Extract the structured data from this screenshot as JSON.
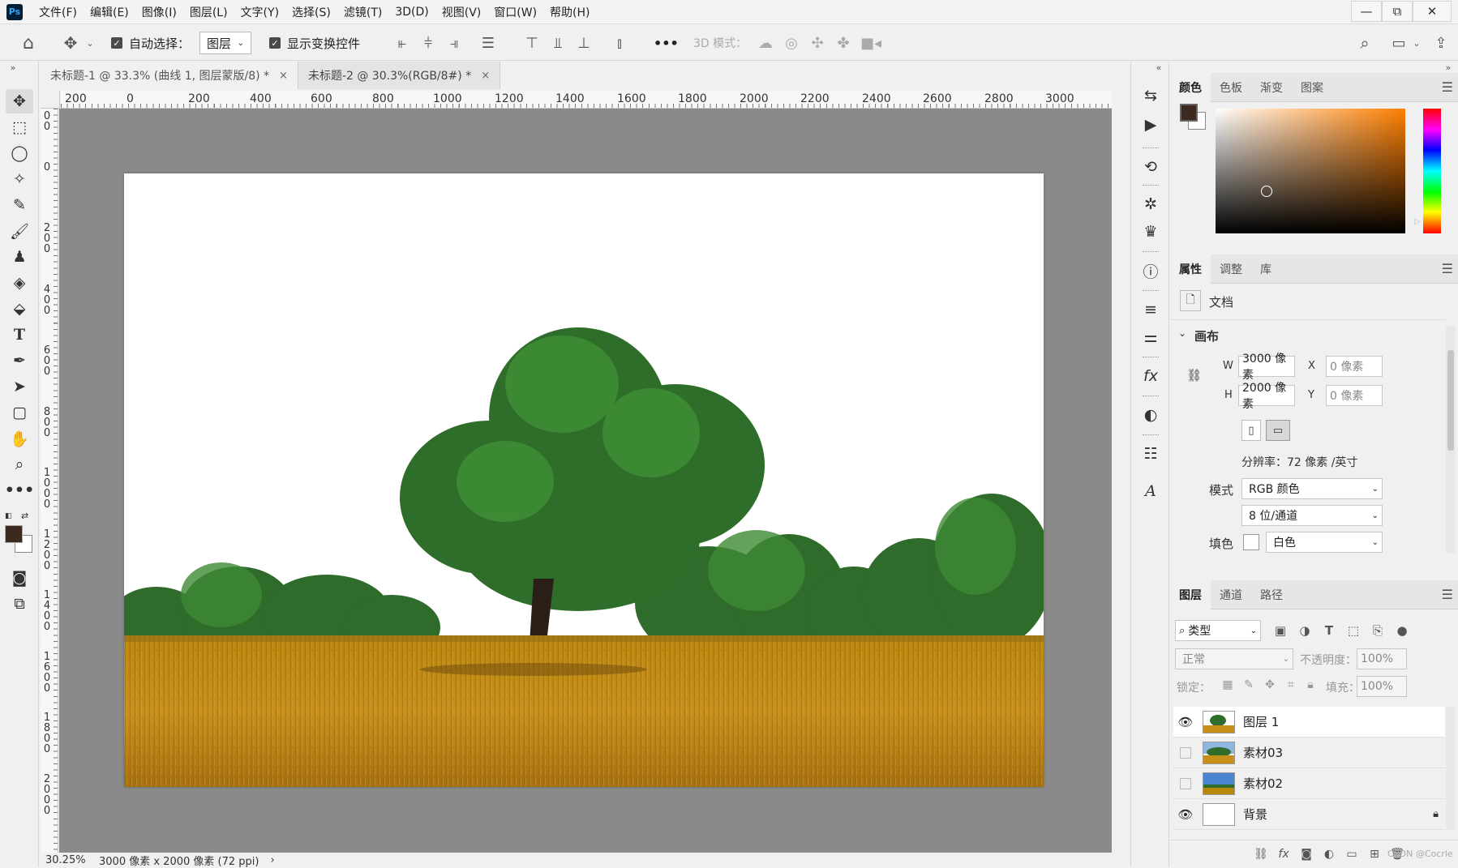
{
  "app": {
    "logo": "Ps"
  },
  "menu": [
    "文件(F)",
    "编辑(E)",
    "图像(I)",
    "图层(L)",
    "文字(Y)",
    "选择(S)",
    "滤镜(T)",
    "3D(D)",
    "视图(V)",
    "窗口(W)",
    "帮助(H)"
  ],
  "window_controls": {
    "minimize": "—",
    "restore": "⧉",
    "close": "✕"
  },
  "options": {
    "auto_select_label": "自动选择：",
    "auto_select_value": "图层",
    "show_transform_label": "显示变换控件",
    "more": "•••",
    "mode_3d_label": "3D 模式："
  },
  "tabs": [
    {
      "label": "未标题-1 @ 33.3% (曲线 1, 图层蒙版/8) *",
      "close": "×"
    },
    {
      "label": "未标题-2 @ 30.3%(RGB/8#) *",
      "close": "×"
    }
  ],
  "ruler_top": [
    "200",
    "0",
    "200",
    "400",
    "600",
    "800",
    "1000",
    "1200",
    "1400",
    "1600",
    "1800",
    "2000",
    "2200",
    "2400",
    "2600",
    "2800",
    "3000"
  ],
  "ruler_left": [
    "200",
    "0",
    "200",
    "400",
    "600",
    "800",
    "1000",
    "1200",
    "1400",
    "1600",
    "1800",
    "2000"
  ],
  "status": {
    "zoom": "30.25%",
    "doc_info": "3000 像素 x 2000 像素 (72 ppi)",
    "arrow": "›"
  },
  "color_panel": {
    "tabs": [
      "颜色",
      "色板",
      "渐变",
      "图案"
    ],
    "fg_color": "#3d2a1e",
    "bg_color": "#ffffff",
    "hue_color": "#ff7f00"
  },
  "props_panel": {
    "tabs": [
      "属性",
      "调整",
      "库"
    ],
    "doc_label": "文档",
    "section": "画布",
    "w_label": "W",
    "w_value": "3000 像素",
    "h_label": "H",
    "h_value": "2000 像素",
    "x_label": "X",
    "x_value": "0 像素",
    "y_label": "Y",
    "y_value": "0 像素",
    "resolution": "分辨率：72 像素 /英寸",
    "mode_label": "模式",
    "mode_value": "RGB 颜色",
    "depth_value": "8 位/通道",
    "fill_label": "填色",
    "fill_value": "白色"
  },
  "layers_panel": {
    "tabs": [
      "图层",
      "通道",
      "路径"
    ],
    "filter_value": "类型",
    "blend_value": "正常",
    "opacity_label": "不透明度：",
    "opacity_value": "100%",
    "lock_label": "锁定：",
    "fill_label": "填充：",
    "fill_value": "100%",
    "layers": [
      {
        "name": "图层 1",
        "visible": true
      },
      {
        "name": "素材03",
        "visible": false
      },
      {
        "name": "素材02",
        "visible": false
      },
      {
        "name": "背景",
        "visible": true,
        "locked": true
      }
    ],
    "watermark": "CSDN @Cocrle"
  }
}
